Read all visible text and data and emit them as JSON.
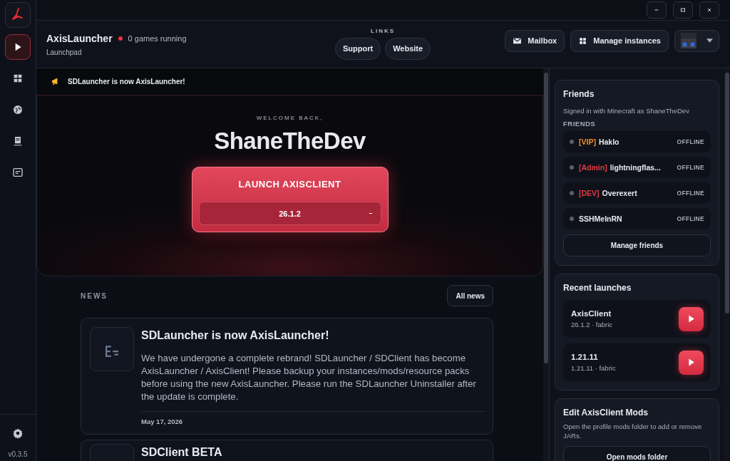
{
  "window": {
    "controls": [
      {
        "kind": "minimize"
      },
      {
        "kind": "maximize"
      },
      {
        "kind": "close"
      }
    ]
  },
  "sidebar": {
    "items": [
      {
        "selected": true
      },
      {
        "selected": false
      },
      {
        "selected": false
      },
      {
        "selected": false
      },
      {
        "selected": false
      }
    ],
    "version": "v0.3.5"
  },
  "header": {
    "title": "AxisLauncher",
    "running": "0 games running",
    "subtitle": "Launchpad",
    "links_label": "LINKS",
    "links": [
      "Support",
      "Website"
    ],
    "buttons": [
      "Mailbox",
      "Manage instances"
    ]
  },
  "announcement": "SDLauncher is now AxisLauncher!",
  "hero": {
    "greeting": "WELCOME BACK,",
    "username": "ShaneTheDev",
    "launch": "LAUNCH AXISCLIENT",
    "version": "26.1.2"
  },
  "news": {
    "heading": "NEWS",
    "all_button": "All news",
    "items": [
      {
        "title": "SDLauncher is now AxisLauncher!",
        "body": "We have undergone a complete rebrand! SDLauncher / SDClient has become AxisLauncher / AxisClient! Please backup your instances/mods/resource packs before using the new AxisLauncher. Please run the SDLauncher Uninstaller after the update is complete.",
        "date": "May 17, 2026"
      },
      {
        "title": "SDClient BETA"
      }
    ]
  },
  "friends": {
    "title": "Friends",
    "signed_in": "Signed in with Minecraft as ShaneTheDev",
    "list_label": "FRIENDS",
    "items": [
      {
        "tag": "[VIP]",
        "color": "#f0902c",
        "name": "Haklo",
        "status": "OFFLINE",
        "online": false
      },
      {
        "tag": "[Admin]",
        "color": "#e5393f",
        "name": "lightningflas...",
        "status": "OFFLINE",
        "online": false
      },
      {
        "tag": "[DEV]",
        "color": "#e5393f",
        "name": "Overexert",
        "status": "OFFLINE",
        "online": false
      },
      {
        "name": "SSHMeInRN",
        "status": "OFFLINE",
        "online": false
      }
    ],
    "manage": "Manage friends"
  },
  "recent": {
    "title": "Recent launches",
    "items": [
      {
        "name": "AxisClient",
        "detail": "26.1.2 · fabric"
      },
      {
        "name": "1.21.11",
        "detail": "1.21.11 · fabric"
      }
    ]
  },
  "mods": {
    "title": "Edit AxisClient Mods",
    "text": "Open the profile mods folder to add or remove JARs.",
    "button": "Open mods folder"
  }
}
